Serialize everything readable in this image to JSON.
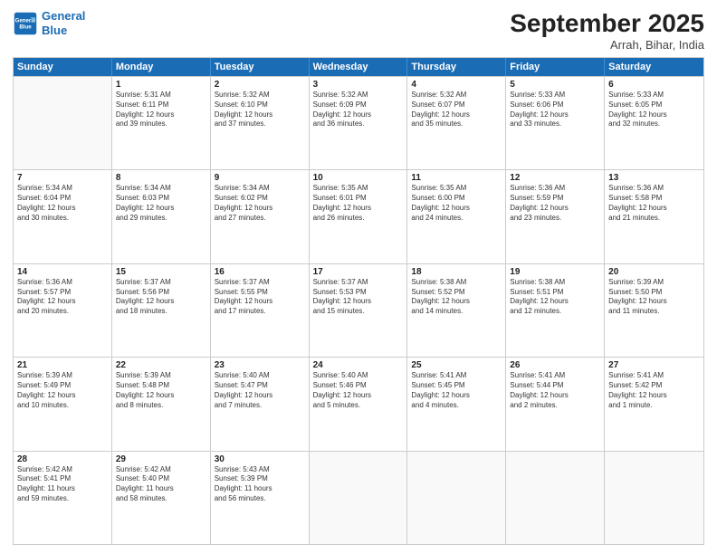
{
  "header": {
    "logo_line1": "General",
    "logo_line2": "Blue",
    "month": "September 2025",
    "location": "Arrah, Bihar, India"
  },
  "days_of_week": [
    "Sunday",
    "Monday",
    "Tuesday",
    "Wednesday",
    "Thursday",
    "Friday",
    "Saturday"
  ],
  "rows": [
    [
      {
        "day": "",
        "text": ""
      },
      {
        "day": "1",
        "text": "Sunrise: 5:31 AM\nSunset: 6:11 PM\nDaylight: 12 hours\nand 39 minutes."
      },
      {
        "day": "2",
        "text": "Sunrise: 5:32 AM\nSunset: 6:10 PM\nDaylight: 12 hours\nand 37 minutes."
      },
      {
        "day": "3",
        "text": "Sunrise: 5:32 AM\nSunset: 6:09 PM\nDaylight: 12 hours\nand 36 minutes."
      },
      {
        "day": "4",
        "text": "Sunrise: 5:32 AM\nSunset: 6:07 PM\nDaylight: 12 hours\nand 35 minutes."
      },
      {
        "day": "5",
        "text": "Sunrise: 5:33 AM\nSunset: 6:06 PM\nDaylight: 12 hours\nand 33 minutes."
      },
      {
        "day": "6",
        "text": "Sunrise: 5:33 AM\nSunset: 6:05 PM\nDaylight: 12 hours\nand 32 minutes."
      }
    ],
    [
      {
        "day": "7",
        "text": "Sunrise: 5:34 AM\nSunset: 6:04 PM\nDaylight: 12 hours\nand 30 minutes."
      },
      {
        "day": "8",
        "text": "Sunrise: 5:34 AM\nSunset: 6:03 PM\nDaylight: 12 hours\nand 29 minutes."
      },
      {
        "day": "9",
        "text": "Sunrise: 5:34 AM\nSunset: 6:02 PM\nDaylight: 12 hours\nand 27 minutes."
      },
      {
        "day": "10",
        "text": "Sunrise: 5:35 AM\nSunset: 6:01 PM\nDaylight: 12 hours\nand 26 minutes."
      },
      {
        "day": "11",
        "text": "Sunrise: 5:35 AM\nSunset: 6:00 PM\nDaylight: 12 hours\nand 24 minutes."
      },
      {
        "day": "12",
        "text": "Sunrise: 5:36 AM\nSunset: 5:59 PM\nDaylight: 12 hours\nand 23 minutes."
      },
      {
        "day": "13",
        "text": "Sunrise: 5:36 AM\nSunset: 5:58 PM\nDaylight: 12 hours\nand 21 minutes."
      }
    ],
    [
      {
        "day": "14",
        "text": "Sunrise: 5:36 AM\nSunset: 5:57 PM\nDaylight: 12 hours\nand 20 minutes."
      },
      {
        "day": "15",
        "text": "Sunrise: 5:37 AM\nSunset: 5:56 PM\nDaylight: 12 hours\nand 18 minutes."
      },
      {
        "day": "16",
        "text": "Sunrise: 5:37 AM\nSunset: 5:55 PM\nDaylight: 12 hours\nand 17 minutes."
      },
      {
        "day": "17",
        "text": "Sunrise: 5:37 AM\nSunset: 5:53 PM\nDaylight: 12 hours\nand 15 minutes."
      },
      {
        "day": "18",
        "text": "Sunrise: 5:38 AM\nSunset: 5:52 PM\nDaylight: 12 hours\nand 14 minutes."
      },
      {
        "day": "19",
        "text": "Sunrise: 5:38 AM\nSunset: 5:51 PM\nDaylight: 12 hours\nand 12 minutes."
      },
      {
        "day": "20",
        "text": "Sunrise: 5:39 AM\nSunset: 5:50 PM\nDaylight: 12 hours\nand 11 minutes."
      }
    ],
    [
      {
        "day": "21",
        "text": "Sunrise: 5:39 AM\nSunset: 5:49 PM\nDaylight: 12 hours\nand 10 minutes."
      },
      {
        "day": "22",
        "text": "Sunrise: 5:39 AM\nSunset: 5:48 PM\nDaylight: 12 hours\nand 8 minutes."
      },
      {
        "day": "23",
        "text": "Sunrise: 5:40 AM\nSunset: 5:47 PM\nDaylight: 12 hours\nand 7 minutes."
      },
      {
        "day": "24",
        "text": "Sunrise: 5:40 AM\nSunset: 5:46 PM\nDaylight: 12 hours\nand 5 minutes."
      },
      {
        "day": "25",
        "text": "Sunrise: 5:41 AM\nSunset: 5:45 PM\nDaylight: 12 hours\nand 4 minutes."
      },
      {
        "day": "26",
        "text": "Sunrise: 5:41 AM\nSunset: 5:44 PM\nDaylight: 12 hours\nand 2 minutes."
      },
      {
        "day": "27",
        "text": "Sunrise: 5:41 AM\nSunset: 5:42 PM\nDaylight: 12 hours\nand 1 minute."
      }
    ],
    [
      {
        "day": "28",
        "text": "Sunrise: 5:42 AM\nSunset: 5:41 PM\nDaylight: 11 hours\nand 59 minutes."
      },
      {
        "day": "29",
        "text": "Sunrise: 5:42 AM\nSunset: 5:40 PM\nDaylight: 11 hours\nand 58 minutes."
      },
      {
        "day": "30",
        "text": "Sunrise: 5:43 AM\nSunset: 5:39 PM\nDaylight: 11 hours\nand 56 minutes."
      },
      {
        "day": "",
        "text": ""
      },
      {
        "day": "",
        "text": ""
      },
      {
        "day": "",
        "text": ""
      },
      {
        "day": "",
        "text": ""
      }
    ]
  ]
}
